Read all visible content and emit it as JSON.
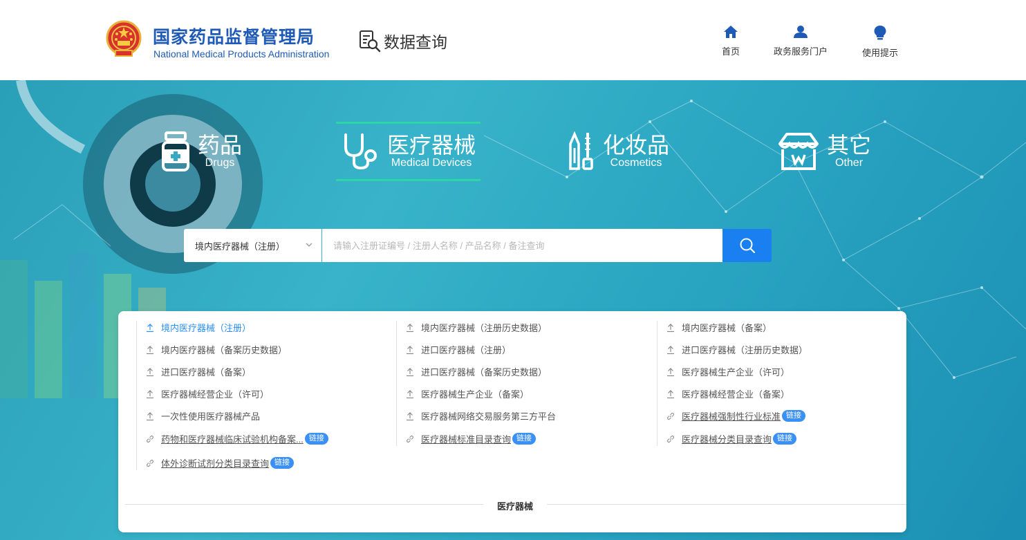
{
  "header": {
    "logo_cn": "国家药品监督管理局",
    "logo_en": "National Medical Products Administration",
    "data_query": "数据查询",
    "nav": [
      {
        "label": "首页",
        "icon": "home-icon"
      },
      {
        "label": "政务服务门户",
        "icon": "user-icon"
      },
      {
        "label": "使用提示",
        "icon": "lightbulb-icon"
      }
    ],
    "brand_color": "#1f5bb6"
  },
  "categories": [
    {
      "cn": "药品",
      "en": "Drugs",
      "icon": "medicine-bottle-icon",
      "active": false
    },
    {
      "cn": "医疗器械",
      "en": "Medical Devices",
      "icon": "stethoscope-icon",
      "active": true
    },
    {
      "cn": "化妆品",
      "en": "Cosmetics",
      "icon": "cosmetics-icon",
      "active": false
    },
    {
      "cn": "其它",
      "en": "Other",
      "icon": "store-icon",
      "active": false
    }
  ],
  "search": {
    "selected": "境内医疗器械（注册）",
    "placeholder": "请输入注册证编号 / 注册人名称 / 产品名称 / 备注查询",
    "button_color": "#1a7ff0"
  },
  "card": {
    "columns": [
      [
        {
          "label": "境内医疗器械（注册）",
          "type": "upload",
          "active": true
        },
        {
          "label": "境内医疗器械（备案历史数据）",
          "type": "upload"
        },
        {
          "label": "进口医疗器械（备案）",
          "type": "upload"
        },
        {
          "label": "医疗器械经营企业（许可）",
          "type": "upload"
        },
        {
          "label": "一次性使用医疗器械产品",
          "type": "upload"
        },
        {
          "label": "药物和医疗器械临床试验机构备案...",
          "type": "link",
          "badge": "链接"
        },
        {
          "label": "体外诊断试剂分类目录查询",
          "type": "link",
          "badge": "链接"
        }
      ],
      [
        {
          "label": "境内医疗器械（注册历史数据）",
          "type": "upload"
        },
        {
          "label": "进口医疗器械（注册）",
          "type": "upload"
        },
        {
          "label": "进口医疗器械（备案历史数据）",
          "type": "upload"
        },
        {
          "label": "医疗器械生产企业（备案）",
          "type": "upload"
        },
        {
          "label": "医疗器械网络交易服务第三方平台",
          "type": "upload"
        },
        {
          "label": "医疗器械标准目录查询",
          "type": "link",
          "badge": "链接"
        }
      ],
      [
        {
          "label": "境内医疗器械（备案）",
          "type": "upload"
        },
        {
          "label": "进口医疗器械（注册历史数据）",
          "type": "upload"
        },
        {
          "label": "医疗器械生产企业（许可）",
          "type": "upload"
        },
        {
          "label": "医疗器械经营企业（备案）",
          "type": "upload"
        },
        {
          "label": "医疗器械强制性行业标准",
          "type": "link",
          "badge": "链接"
        },
        {
          "label": "医疗器械分类目录查询",
          "type": "link",
          "badge": "链接"
        }
      ]
    ],
    "footer_label": "医疗器械",
    "active_color": "#2a8ff7",
    "badge_color": "#3a90f5"
  }
}
